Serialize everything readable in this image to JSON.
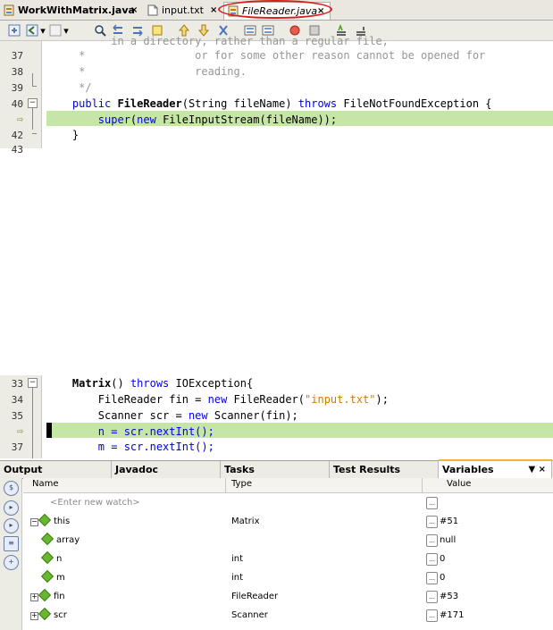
{
  "editor_tabs": [
    {
      "label": "WorkWithMatrix.java",
      "close": "×"
    },
    {
      "label": "input.txt",
      "close": "×"
    },
    {
      "label": "FileReader.java",
      "close": "×"
    }
  ],
  "top_editor": {
    "lines": [
      {
        "num": "37"
      },
      {
        "num": "38"
      },
      {
        "num": "39"
      },
      {
        "num": "40"
      },
      {
        "num": "",
        "marker": "⇨"
      },
      {
        "num": "42"
      },
      {
        "num": "43"
      }
    ],
    "code": {
      "l0_head": "          ",
      "l0_comment": "in a directory, rather than a regular file,",
      "l1_comment": "     *                 or for some other reason cannot be opened for",
      "l2_comment": "     *                 reading.",
      "l3_comment": "     */",
      "l4_kw1": "    public ",
      "l4_name": "FileReader",
      "l4_mid": "(String fileName) ",
      "l4_kw2": "throws",
      "l4_tail": " FileNotFoundException {",
      "l5_kw1": "        super",
      "l5_mid": "(",
      "l5_kw2": "new",
      "l5_tail": " FileInputStream(fileName));",
      "l6": "    }"
    }
  },
  "bottom_editor": {
    "lines": [
      {
        "num": "33"
      },
      {
        "num": "34"
      },
      {
        "num": "35"
      },
      {
        "num": "",
        "marker": "⇨"
      },
      {
        "num": "37"
      }
    ],
    "code": {
      "l0_name": "    Matrix",
      "l0_mid": "() ",
      "l0_kw": "throws",
      "l0_tail": " IOException{",
      "l1_head": "        FileReader fin = ",
      "l1_kw": "new",
      "l1_mid": " FileReader(",
      "l1_str": "\"input.txt\"",
      "l1_tail": ");",
      "l2_head": "        Scanner scr = ",
      "l2_kw": "new",
      "l2_tail": " Scanner(fin);",
      "l3": "        n = scr.nextInt();",
      "l4": "        m = scr.nextInt();"
    }
  },
  "panel": {
    "tabs": [
      "Output",
      "Javadoc",
      "Tasks",
      "Test Results",
      "Variables"
    ],
    "active_tab_controls": "▼ ×",
    "columns": {
      "name": "Name",
      "type": "Type",
      "value": "Value"
    },
    "watch_placeholder": "<Enter new watch>",
    "rows": [
      {
        "name": "this",
        "type": "Matrix",
        "value": "#51"
      },
      {
        "name": "array",
        "type": "",
        "value": "null"
      },
      {
        "name": "n",
        "type": "int",
        "value": "0"
      },
      {
        "name": "m",
        "type": "int",
        "value": "0"
      },
      {
        "name": "fin",
        "type": "FileReader",
        "value": "#53"
      },
      {
        "name": "scr",
        "type": "Scanner",
        "value": "#171"
      }
    ]
  },
  "colors": {
    "highlight_line": "#c6e6a7",
    "keyword": "#0000e6",
    "string": "#ce7b00",
    "callout": "#d81f1f"
  }
}
